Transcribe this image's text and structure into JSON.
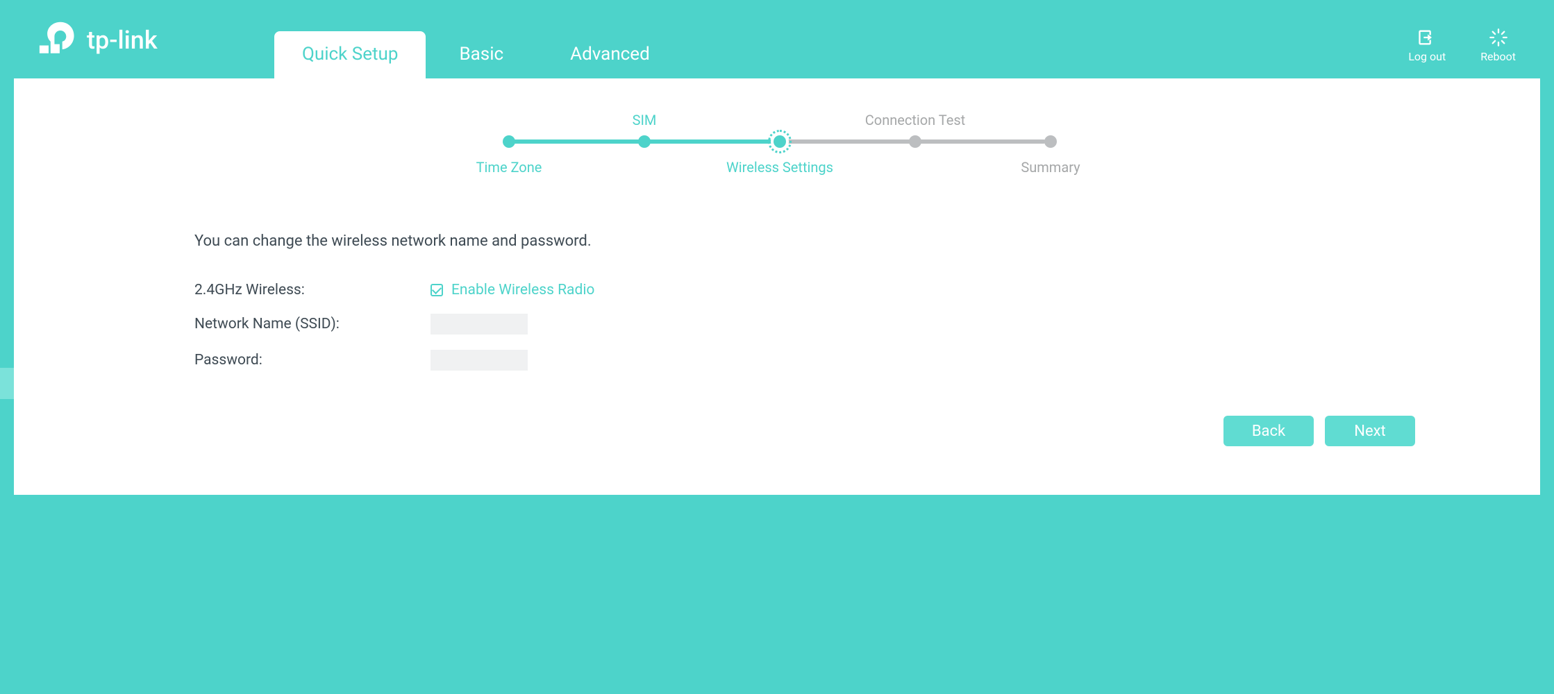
{
  "brand": "tp-link",
  "header": {
    "tabs": [
      {
        "label": "Quick Setup"
      },
      {
        "label": "Basic"
      },
      {
        "label": "Advanced"
      }
    ],
    "active_tab": 0,
    "actions": {
      "logout_label": "Log out",
      "reboot_label": "Reboot"
    }
  },
  "wizard": {
    "steps": [
      {
        "label": "Time Zone",
        "status": "done",
        "position": "bottom"
      },
      {
        "label": "SIM",
        "status": "done",
        "position": "top"
      },
      {
        "label": "Wireless Settings",
        "status": "current",
        "position": "bottom"
      },
      {
        "label": "Connection Test",
        "status": "todo",
        "position": "top"
      },
      {
        "label": "Summary",
        "status": "todo",
        "position": "bottom"
      }
    ]
  },
  "content": {
    "intro": "You can change the wireless network name and password.",
    "wireless_label": "2.4GHz Wireless:",
    "enable_radio_checked": true,
    "enable_radio_label": "Enable Wireless Radio",
    "ssid_label": "Network Name (SSID):",
    "ssid_value": "",
    "password_label": "Password:",
    "password_value": ""
  },
  "buttons": {
    "back": "Back",
    "next": "Next"
  }
}
